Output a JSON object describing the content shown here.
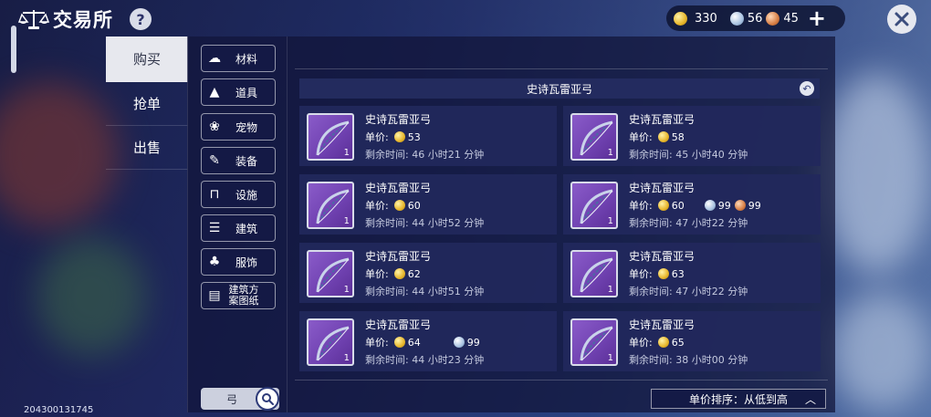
{
  "header": {
    "title": "交易所",
    "help_label": "?"
  },
  "currency": {
    "gold": "330",
    "silver": "56",
    "copper": "45",
    "plus_label": "+"
  },
  "main_tabs": [
    {
      "label": "购买",
      "active": true
    },
    {
      "label": "抢单",
      "active": false
    },
    {
      "label": "出售",
      "active": false
    }
  ],
  "categories": [
    {
      "label": "材料",
      "icon": "material-icon"
    },
    {
      "label": "道具",
      "icon": "prop-icon"
    },
    {
      "label": "宠物",
      "icon": "paw-icon"
    },
    {
      "label": "装备",
      "icon": "equipment-icon"
    },
    {
      "label": "设施",
      "icon": "facility-icon"
    },
    {
      "label": "建筑",
      "icon": "building-icon"
    },
    {
      "label": "服饰",
      "icon": "clothing-icon"
    },
    {
      "label": "建筑方案图纸",
      "icon": "blueprint-icon"
    }
  ],
  "search": {
    "value": "弓"
  },
  "uid": "204300131745",
  "item_header": "史诗瓦雷亚弓",
  "price_label": "单价:",
  "time_label": "剩余时间:",
  "listings": [
    {
      "name": "史诗瓦雷亚弓",
      "qty": "1",
      "gold": "53",
      "time": "46 小时21 分钟"
    },
    {
      "name": "史诗瓦雷亚弓",
      "qty": "1",
      "gold": "58",
      "time": "45 小时40 分钟"
    },
    {
      "name": "史诗瓦雷亚弓",
      "qty": "1",
      "gold": "60",
      "time": "44 小时52 分钟"
    },
    {
      "name": "史诗瓦雷亚弓",
      "qty": "1",
      "gold": "60",
      "silver": "99",
      "copper": "99",
      "time": "47 小时22 分钟"
    },
    {
      "name": "史诗瓦雷亚弓",
      "qty": "1",
      "gold": "62",
      "time": "44 小时51 分钟"
    },
    {
      "name": "史诗瓦雷亚弓",
      "qty": "1",
      "gold": "63",
      "time": "47 小时22 分钟"
    },
    {
      "name": "史诗瓦雷亚弓",
      "qty": "1",
      "gold": "64",
      "silver": "99",
      "time": "44 小时23 分钟"
    },
    {
      "name": "史诗瓦雷亚弓",
      "qty": "1",
      "gold": "65",
      "time": "38 小时00 分钟"
    }
  ],
  "sort": {
    "label": "单价排序：从低到高"
  },
  "colors": {
    "panel": "#10143a",
    "card": "#22285c",
    "thumb_purple": "#7a4bbd",
    "gold": "#e7b62b",
    "silver": "#a9c3e2",
    "copper": "#d87f45"
  }
}
